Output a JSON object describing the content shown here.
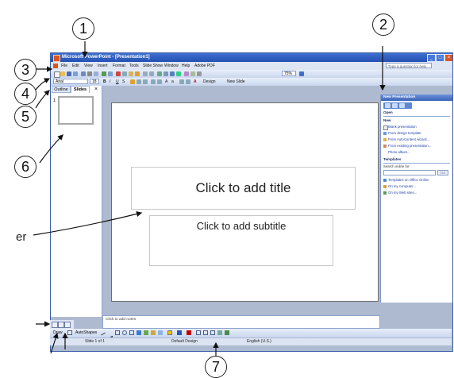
{
  "callouts": [
    "1",
    "2",
    "3",
    "4",
    "5",
    "6",
    "7"
  ],
  "fragments": {
    "left_label": "er"
  },
  "window": {
    "title": "Microsoft PowerPoint - [Presentation1]",
    "ask_placeholder": "Type a question for help",
    "controls": {
      "min": "_",
      "max": "□",
      "close": "×"
    }
  },
  "menu": [
    "File",
    "Edit",
    "View",
    "Insert",
    "Format",
    "Tools",
    "Slide Show",
    "Window",
    "Help",
    "Adobe PDF"
  ],
  "toolbar": {
    "font": "Arial",
    "size": "18",
    "zoom": "75%",
    "design": "Design",
    "new_slide": "New Slide"
  },
  "left_panel": {
    "tabs": [
      "Outline",
      "Slides"
    ],
    "close": "×",
    "slide_number": "1"
  },
  "slide": {
    "title": "Click to add title",
    "subtitle": "Click to add subtitle"
  },
  "task_pane": {
    "title": "New Presentation",
    "open_header": "Open",
    "new_header": "New",
    "new_links": [
      "Blank presentation",
      "From design template",
      "From AutoContent wizard...",
      "From existing presentation...",
      "Photo album..."
    ],
    "templates_header": "Templates",
    "search_label": "Search online for:",
    "go": "Go",
    "template_links": [
      "Templates on Office Online",
      "On my computer...",
      "On my Web sites..."
    ]
  },
  "notes": "Click to add notes",
  "drawing": {
    "draw": "Draw",
    "autoshapes": "AutoShapes"
  },
  "status": {
    "slide": "Slide 1 of 1",
    "design": "Default Design",
    "language": "English (U.S.)"
  }
}
